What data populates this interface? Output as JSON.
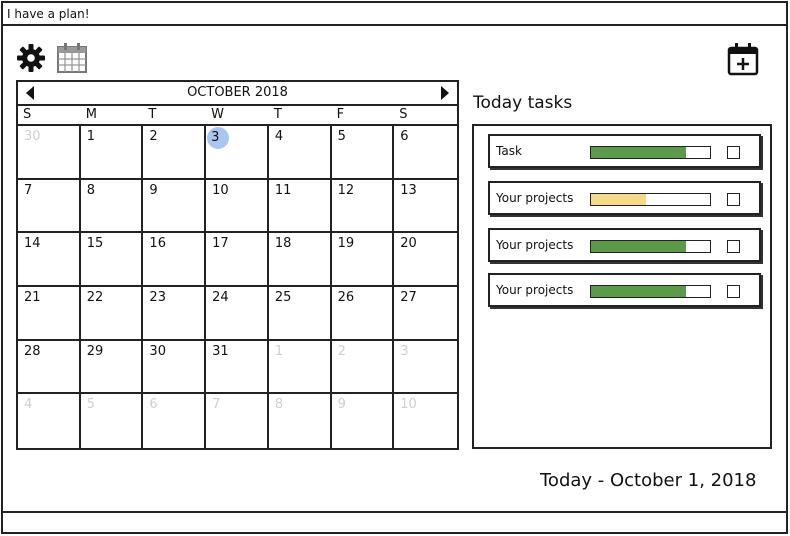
{
  "window": {
    "title": "I have a plan!"
  },
  "toolbar": {
    "settings_icon": "gear-icon",
    "calendar_icon": "calendar-icon",
    "add_event_icon": "calendar-add-icon"
  },
  "calendar": {
    "month_label": "OCTOBER 2018",
    "weekdays": [
      "S",
      "M",
      "T",
      "W",
      "T",
      "F",
      "S"
    ],
    "days": [
      {
        "n": "30",
        "muted": true
      },
      {
        "n": "1"
      },
      {
        "n": "2"
      },
      {
        "n": "3",
        "today": true
      },
      {
        "n": "4"
      },
      {
        "n": "5"
      },
      {
        "n": "6"
      },
      {
        "n": "7"
      },
      {
        "n": "8"
      },
      {
        "n": "9"
      },
      {
        "n": "10"
      },
      {
        "n": "11"
      },
      {
        "n": "12"
      },
      {
        "n": "13"
      },
      {
        "n": "14"
      },
      {
        "n": "15"
      },
      {
        "n": "16"
      },
      {
        "n": "17"
      },
      {
        "n": "18"
      },
      {
        "n": "19"
      },
      {
        "n": "20"
      },
      {
        "n": "21"
      },
      {
        "n": "22"
      },
      {
        "n": "23"
      },
      {
        "n": "24"
      },
      {
        "n": "25"
      },
      {
        "n": "26"
      },
      {
        "n": "27"
      },
      {
        "n": "28"
      },
      {
        "n": "29"
      },
      {
        "n": "30"
      },
      {
        "n": "31"
      },
      {
        "n": "1",
        "muted": true
      },
      {
        "n": "2",
        "muted": true
      },
      {
        "n": "3",
        "muted": true
      },
      {
        "n": "4",
        "muted": true
      },
      {
        "n": "5",
        "muted": true
      },
      {
        "n": "6",
        "muted": true
      },
      {
        "n": "7",
        "muted": true
      },
      {
        "n": "8",
        "muted": true
      },
      {
        "n": "9",
        "muted": true
      },
      {
        "n": "10",
        "muted": true
      }
    ],
    "today_color": "#a9c6f0"
  },
  "tasks": {
    "title": "Today tasks",
    "items": [
      {
        "label": "Task",
        "progress": 0.8,
        "color": "#5a9a48",
        "checked": false
      },
      {
        "label": "Your projects",
        "progress": 0.46,
        "color": "#f3d98a",
        "checked": false
      },
      {
        "label": "Your projects",
        "progress": 0.8,
        "color": "#5a9a48",
        "checked": false
      },
      {
        "label": "Your projects",
        "progress": 0.8,
        "color": "#5a9a48",
        "checked": false
      }
    ]
  },
  "footer": {
    "today_text": "Today - October 1, 2018"
  }
}
